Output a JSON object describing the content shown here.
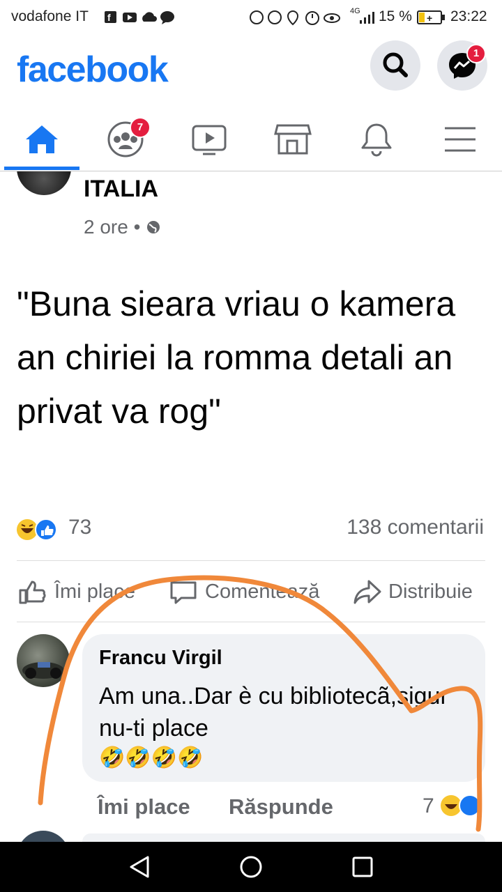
{
  "status_bar": {
    "carrier": "vodafone IT",
    "battery": "15 %",
    "time": "23:22",
    "network": "4G"
  },
  "header": {
    "brand": "facebook",
    "messenger_badge": "1"
  },
  "tabs": [
    {
      "name": "home",
      "icon": "home-icon",
      "active": true
    },
    {
      "name": "groups",
      "icon": "groups-icon",
      "badge": "7"
    },
    {
      "name": "watch",
      "icon": "video-icon"
    },
    {
      "name": "marketplace",
      "icon": "marketplace-icon"
    },
    {
      "name": "notifications",
      "icon": "bell-icon"
    },
    {
      "name": "menu",
      "icon": "menu-icon"
    }
  ],
  "post": {
    "author": "ITALIA",
    "time": "2 ore",
    "body": "\"Buna sieara vriau o kamera an chiriei la romma detali an privat va rog\"",
    "reactions_count": "73",
    "comments_count": "138 comentarii",
    "actions": {
      "like": "Îmi place",
      "comment": "Comentează",
      "share": "Distribuie"
    }
  },
  "comment": {
    "author": "Francu Virgil",
    "text": "Am una..Dar è cu bibliotecã,sigur nu-ti place",
    "emojis": "🤣🤣🤣🤣",
    "like_label": "Îmi place",
    "reply_label": "Răspunde",
    "reactions_count": "7"
  },
  "colors": {
    "brand": "#1877f2",
    "badge": "#e41e3f",
    "scribble": "#f0883a"
  }
}
